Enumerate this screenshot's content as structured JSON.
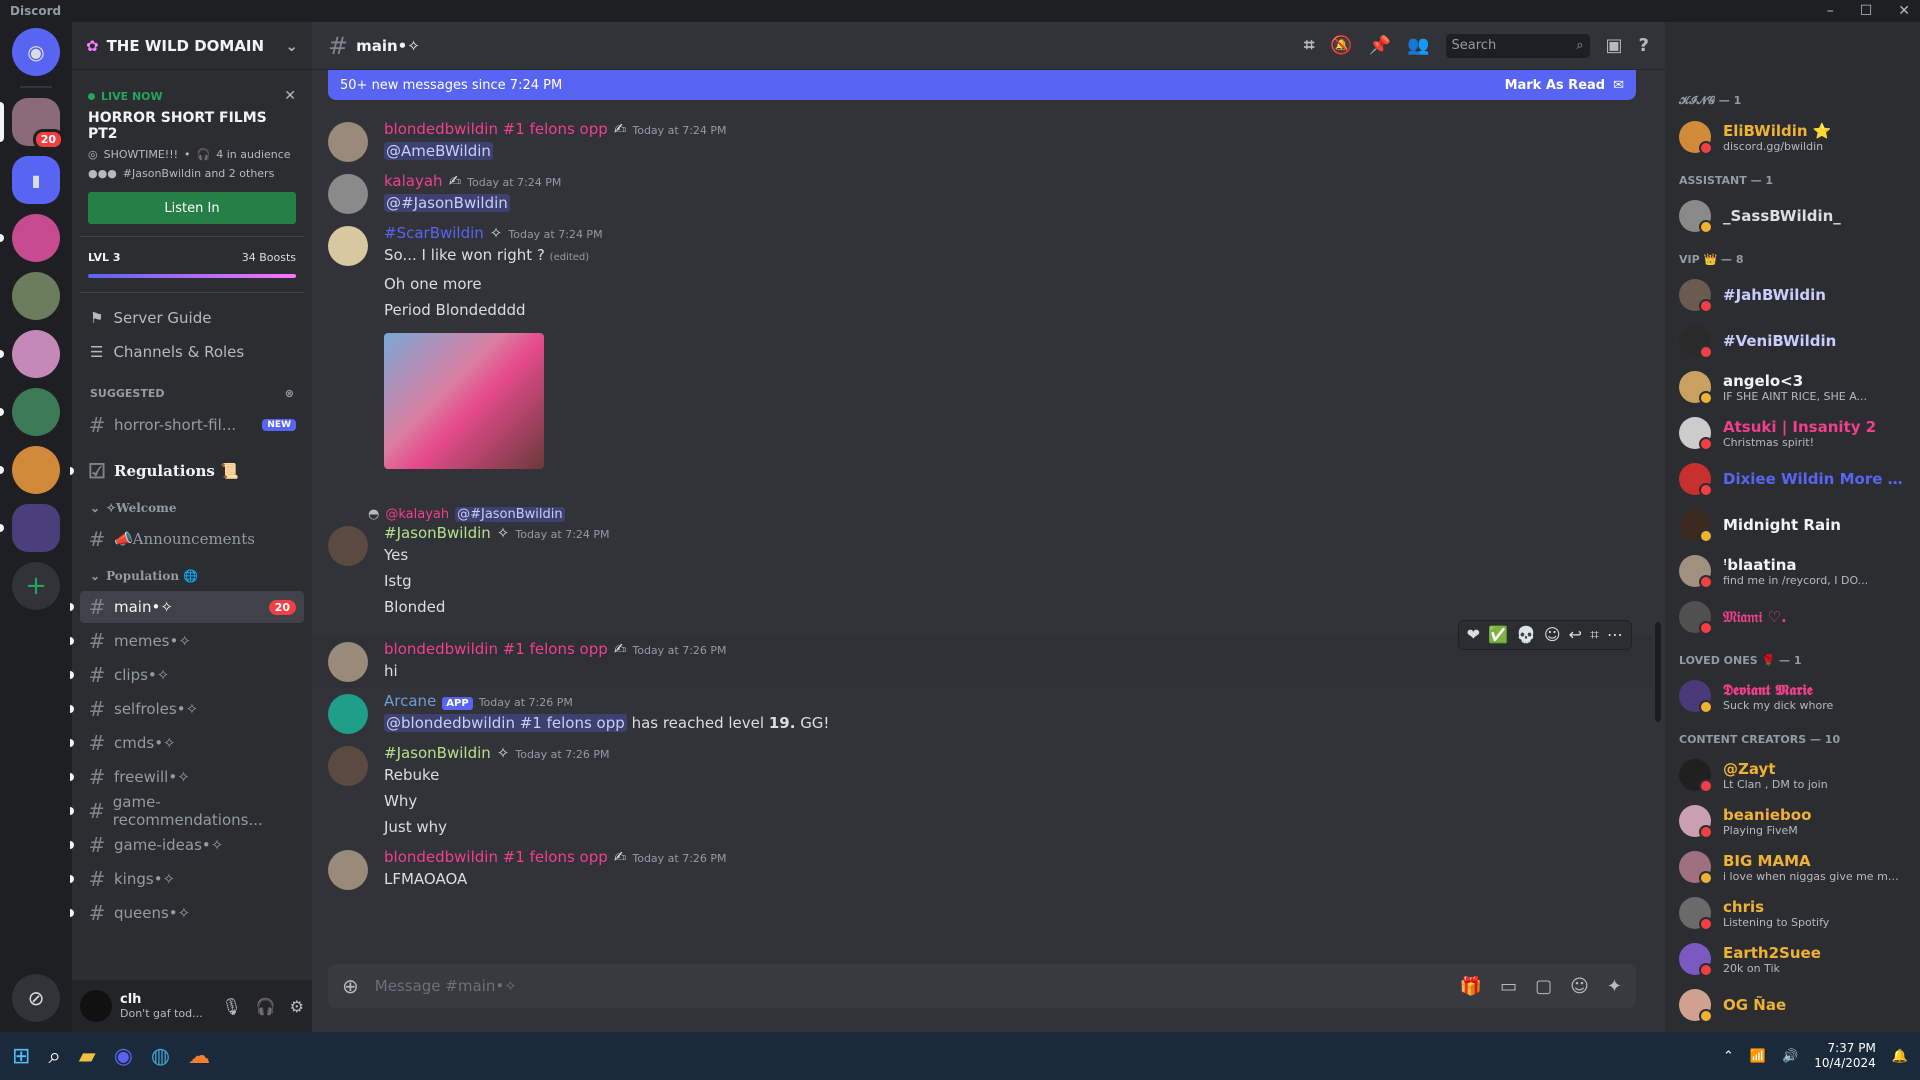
{
  "window": {
    "title": "Discord"
  },
  "guild": {
    "name": "THE WILD DOMAIN"
  },
  "stage": {
    "live_label": "LIVE NOW",
    "title": "HORROR SHORT FILMS PT2",
    "host": "SHOWTIME!!!",
    "audience": "4 in audience",
    "speakers": "#JasonBwildin and 2 others",
    "listen_label": "Listen In"
  },
  "boost": {
    "level": "LVL 3",
    "boosts": "34 Boosts"
  },
  "nav": {
    "server_guide": "Server Guide",
    "channels_roles": "Channels & Roles"
  },
  "suggested": {
    "label": "SUGGESTED",
    "channel": "horror-short-fil...",
    "badge": "NEW"
  },
  "channels": {
    "regulations": "Regulations 📜",
    "welcome_cat": "✧Welcome",
    "announcements": "📣Announcements",
    "population_cat": "Population 🌐",
    "main": "main•✧",
    "main_count": "20",
    "list": [
      "memes•✧",
      "clips•✧",
      "selfroles•✧",
      "cmds•✧",
      "freewill•✧",
      "game-recommendations...",
      "game-ideas•✧",
      "kings•✧",
      "queens•✧"
    ]
  },
  "user": {
    "name": "clh",
    "status": "Don't gaf tod..."
  },
  "header": {
    "channel": "main•✧",
    "search_placeholder": "Search"
  },
  "newbar": {
    "text": "50+ new messages since 7:24 PM",
    "mark": "Mark As Read"
  },
  "messages": [
    {
      "author": "blondedbwildin #1 felons opp",
      "ts": "Today at 7:24 PM",
      "lines": [
        "@AmeBWildin"
      ]
    },
    {
      "author": "kalayah",
      "ts": "Today at 7:24 PM",
      "lines": [
        "@#JasonBwildin"
      ]
    },
    {
      "author": "#ScarBwildin",
      "ts": "Today at 7:24 PM",
      "lines": [
        "So... I like won right ?",
        "Oh one more",
        "Period Blondedddd"
      ],
      "edited": "(edited)"
    },
    {
      "reply_author": "@kalayah",
      "reply_text": "@#JasonBwildin",
      "author": "#JasonBwildin",
      "ts": "Today at 7:24 PM",
      "lines": [
        "Yes",
        "Istg",
        "Blonded"
      ]
    },
    {
      "author": "blondedbwildin #1 felons opp",
      "ts": "Today at 7:26 PM",
      "lines": [
        "hi"
      ]
    },
    {
      "author": "Arcane",
      "app": "APP",
      "ts": "Today at 7:26 PM",
      "mention": "@blondedbwildin #1 felons opp",
      "text_a": "has reached level",
      "level": "19.",
      "text_b": "GG!"
    },
    {
      "author": "#JasonBwildin",
      "ts": "Today at 7:26 PM",
      "lines": [
        "Rebuke",
        "Why",
        "Just why"
      ]
    },
    {
      "author": "blondedbwildin #1 felons opp",
      "ts": "Today at 7:26 PM",
      "lines": [
        "LFMAOAOA"
      ]
    }
  ],
  "composer": {
    "placeholder": "Message #main•✧"
  },
  "members": {
    "roles": [
      "𝓚𝓘𝓝𝓖 — 1",
      "ASSISTANT — 1",
      "VIP 👑 — 8",
      "LOVED ONES 🌹 — 1",
      "CONTENT CREATORS — 10"
    ],
    "king": [
      {
        "name": "EliBWildin ⭐",
        "sub": "discord.gg/bwildin",
        "color": "#f0b232"
      }
    ],
    "assistant": [
      {
        "name": "_SassBWildin_",
        "sub": "",
        "color": "#dbdee1"
      }
    ],
    "vip": [
      {
        "name": "#JahBWildin",
        "sub": "",
        "color": "#c9cdfb"
      },
      {
        "name": "#VeniBWildin",
        "sub": "",
        "color": "#c9cdfb"
      },
      {
        "name": "angelo<3",
        "sub": "IF SHE AINT RICE, SHE A...",
        "color": "#f2f3f5"
      },
      {
        "name": "Atsuki | Insanity 2",
        "sub": "Christmas spirit!",
        "color": "#f23f8b"
      },
      {
        "name": "Dixiee Wildin More ...",
        "sub": "",
        "color": "#5865f2"
      },
      {
        "name": "Midnight Rain",
        "sub": "",
        "color": "#f2f3f5"
      },
      {
        "name": "ꜝblaatina",
        "sub": "find me in /reycord, I DO...",
        "color": "#f2f3f5"
      },
      {
        "name": "𝔐𝔦𝔞𝔪𝔦 ♡.",
        "sub": "",
        "color": "#f23f8b"
      }
    ],
    "loved": [
      {
        "name": "𝕯𝖊𝖛𝖎𝖆𝖓𝖙 𝕸𝖆𝖗𝖎𝖊",
        "sub": "Suck my dick whore",
        "color": "#f23f8b"
      }
    ],
    "creators": [
      {
        "name": "@Zayt",
        "sub": "Lt Clan , DM to join",
        "color": "#f0b232"
      },
      {
        "name": "beanieboo",
        "sub": "Playing FiveM",
        "color": "#f0b232"
      },
      {
        "name": "BIG MAMA",
        "sub": "i love when niggas give me mo...",
        "color": "#f0b232"
      },
      {
        "name": "chris",
        "sub": "Listening to Spotify",
        "color": "#f0b232"
      },
      {
        "name": "Earth2Suee",
        "sub": "20k on Tik",
        "color": "#f0b232"
      },
      {
        "name": "OG Ñae",
        "sub": "",
        "color": "#f0b232"
      }
    ]
  },
  "taskbar": {
    "time": "7:37 PM",
    "date": "10/4/2024"
  }
}
